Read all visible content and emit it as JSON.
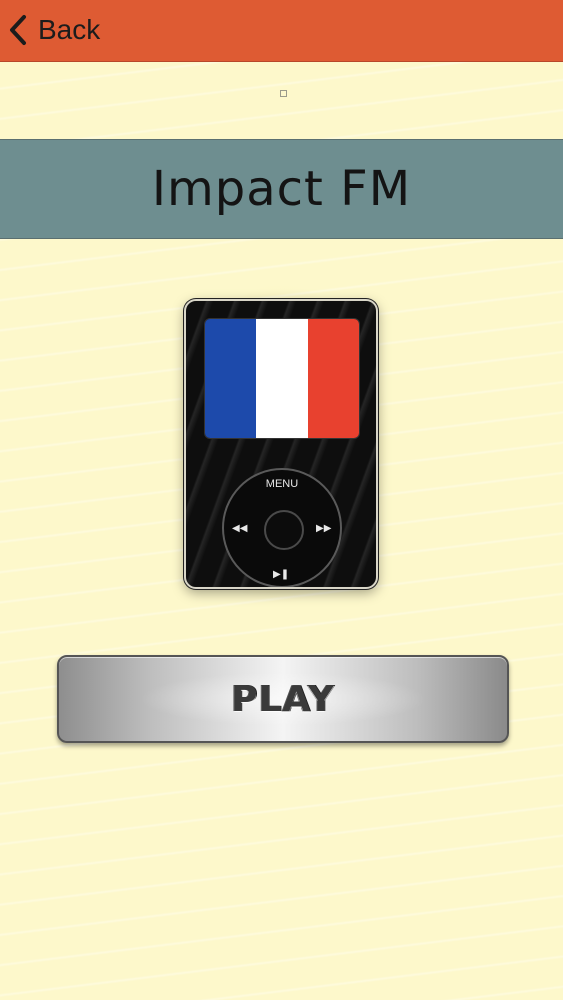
{
  "nav": {
    "back_label": "Back",
    "back_icon": "chevron-left-icon",
    "bar_color": "#de5b33"
  },
  "station": {
    "title": "Impact FM",
    "banner_color": "#6e8e90"
  },
  "player": {
    "wheel_menu_label": "MENU",
    "flag_colors": [
      "#1d4aab",
      "#ffffff",
      "#e8412f"
    ],
    "prev_icon": "rewind-icon",
    "next_icon": "fast-forward-icon",
    "playpause_icon": "play-pause-icon"
  },
  "play_button": {
    "label": "PLAY"
  },
  "colors": {
    "background": "#fdf8cb",
    "accent": "#de5b33"
  }
}
